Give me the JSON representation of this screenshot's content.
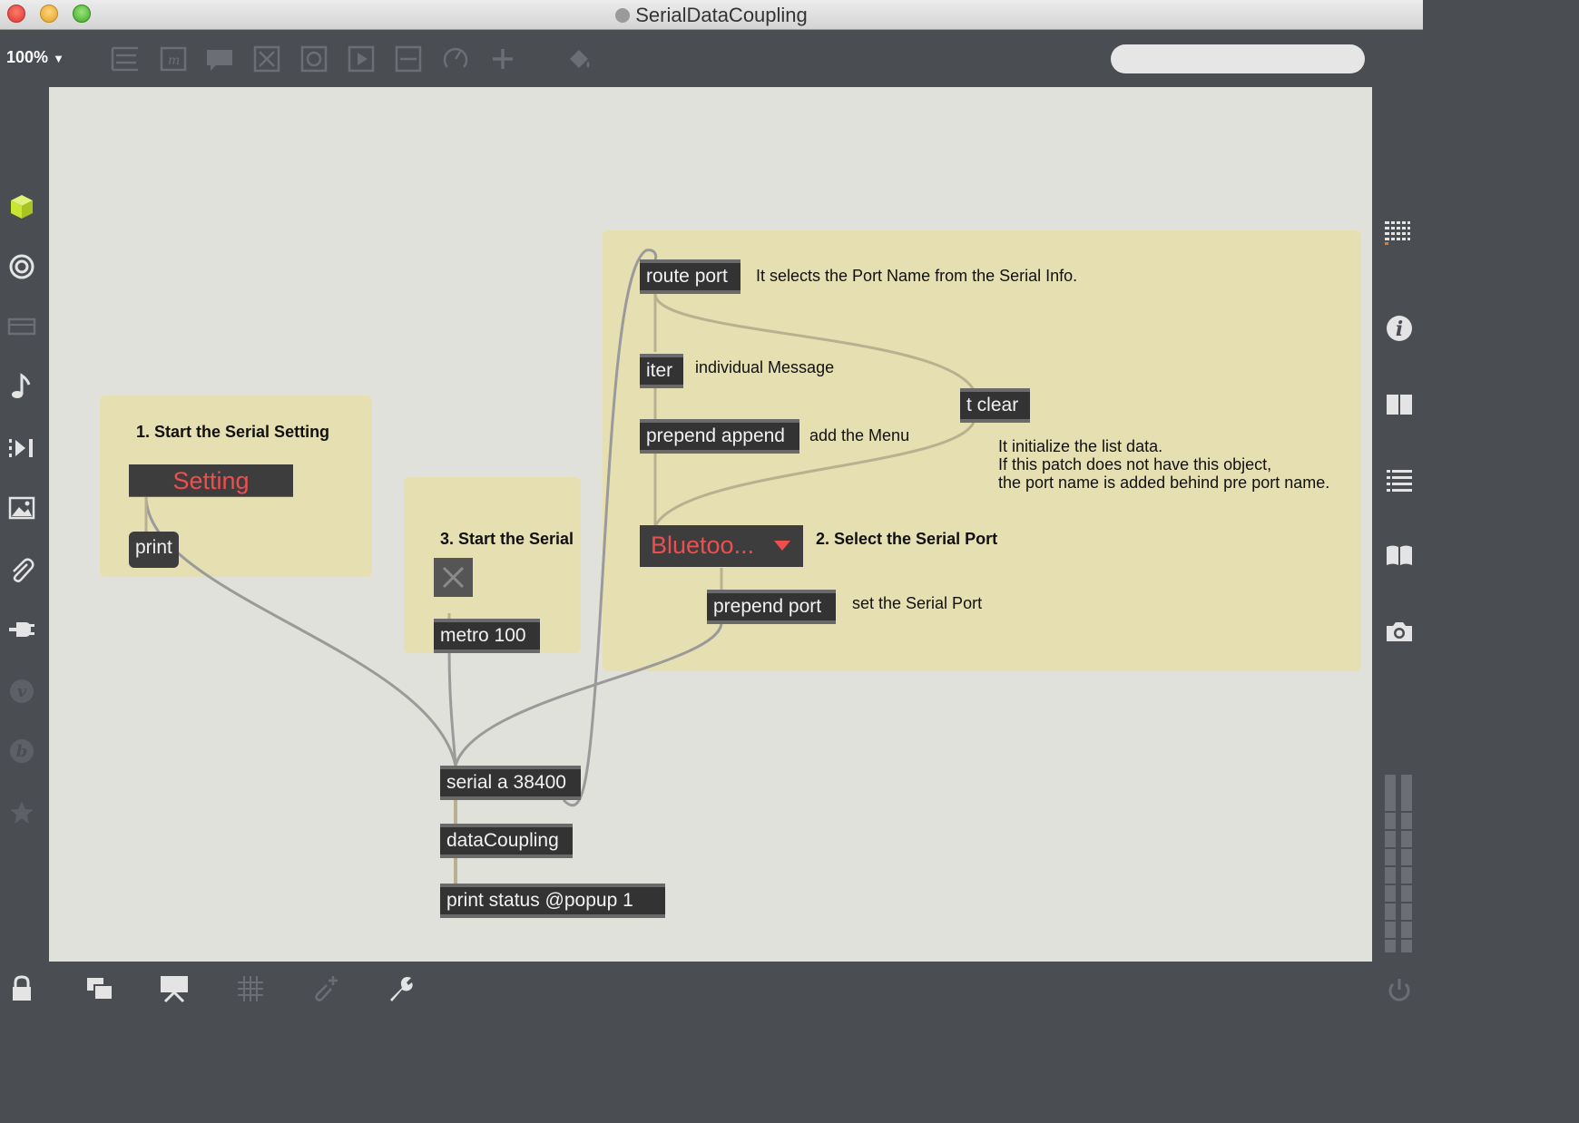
{
  "window": {
    "title": "SerialDataCoupling"
  },
  "toolbar": {
    "zoom": "100%",
    "search_placeholder": ""
  },
  "patch": {
    "panel1_title": "1. Start the Serial Setting",
    "setting_button": "Setting",
    "print_message": "print",
    "panel3_title": "3. Start the Serial",
    "metro": "metro 100",
    "route": "route port",
    "route_comment": "It selects the Port Name from the Serial Info.",
    "iter": "iter",
    "iter_comment": "individual Message",
    "prepend_append": "prepend append",
    "prepend_append_comment": "add the Menu",
    "tclear": "t clear",
    "tclear_comment_1": "It initialize the list data.",
    "tclear_comment_2": "If this patch does not have this object,",
    "tclear_comment_3": "the port name is added behind pre port name.",
    "umenu_value": "Bluetoo...",
    "panel2_title": "2. Select the Serial Port",
    "prepend_port": "prepend port",
    "prepend_port_comment": "set the Serial Port",
    "serial": "serial a 38400",
    "datacoupling": "dataCoupling",
    "print_status": "print status @popup 1"
  },
  "colors": {
    "canvas": "#e1e1db",
    "panel": "#e6dfb1",
    "object": "#333333",
    "accent_red": "#ef4e4e",
    "cube": "#c8e632",
    "patchcord": "#9a9a9a"
  },
  "icons": {
    "left": [
      "package-cube-icon",
      "target-icon",
      "keyboard-icon",
      "note-icon",
      "step-play-icon",
      "image-icon",
      "paperclip-icon",
      "plug-icon",
      "v-icon",
      "b-icon",
      "star-icon"
    ],
    "right": [
      "grid-icon",
      "info-icon",
      "columns-icon",
      "list-icon",
      "book-icon",
      "camera-icon",
      "meter-icon",
      "power-icon"
    ],
    "bottom": [
      "lock-icon",
      "windows-icon",
      "presentation-icon",
      "grid-snap-icon",
      "clip-add-icon",
      "wrench-icon"
    ]
  }
}
